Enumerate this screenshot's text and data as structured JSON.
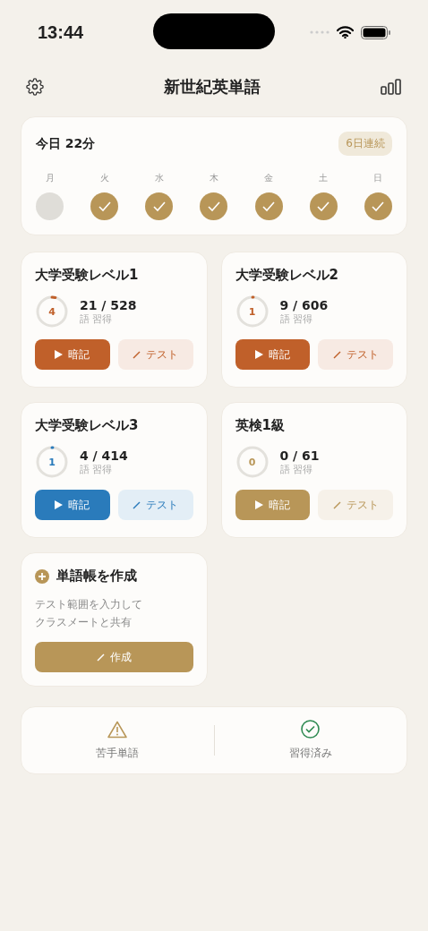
{
  "status_bar": {
    "time": "13:44"
  },
  "header": {
    "title": "新世紀英単語"
  },
  "today": {
    "label": "今日 22分",
    "streak": "6日連続",
    "days": [
      {
        "label": "月",
        "done": false
      },
      {
        "label": "火",
        "done": true
      },
      {
        "label": "水",
        "done": true
      },
      {
        "label": "木",
        "done": true
      },
      {
        "label": "金",
        "done": true
      },
      {
        "label": "土",
        "done": true
      },
      {
        "label": "日",
        "done": true
      }
    ]
  },
  "decks": [
    {
      "title": "大学受験レベル1",
      "percent": "4",
      "count": "21 / 528",
      "unit": "語 習得",
      "color": "#c0602a",
      "study": "暗記",
      "test": "テスト"
    },
    {
      "title": "大学受験レベル2",
      "percent": "1",
      "count": "9 / 606",
      "unit": "語 習得",
      "color": "#c0602a",
      "study": "暗記",
      "test": "テスト"
    },
    {
      "title": "大学受験レベル3",
      "percent": "1",
      "count": "4 / 414",
      "unit": "語 習得",
      "color": "#2a7bbb",
      "study": "暗記",
      "test": "テスト"
    },
    {
      "title": "英検1級",
      "percent": "0",
      "count": "0 / 61",
      "unit": "語 習得",
      "color": "#b89658",
      "study": "暗記",
      "test": "テスト"
    }
  ],
  "create_card": {
    "title": "単語帳を作成",
    "description": [
      "テスト範囲を入力して",
      "クラスメートと共有"
    ],
    "button": "作成"
  },
  "bottom_links": [
    {
      "kind": "weak",
      "label": "苦手単語"
    },
    {
      "kind": "learned",
      "label": "習得済み"
    }
  ]
}
